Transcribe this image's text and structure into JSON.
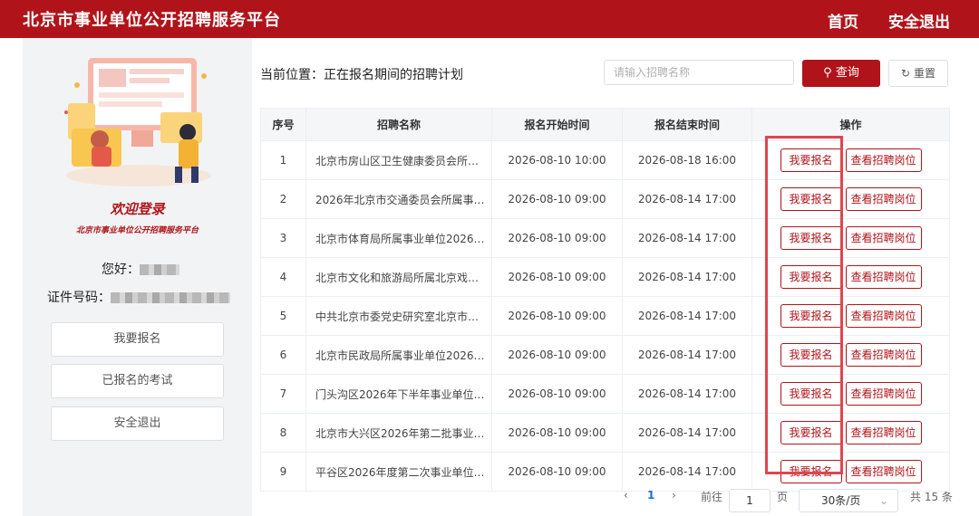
{
  "header": {
    "title": "北京市事业单位公开招聘服务平台",
    "nav_home": "首页",
    "nav_logout": "安全退出"
  },
  "sidebar": {
    "welcome": "欢迎登录",
    "platform_name": "北京市事业单位公开招聘服务平台",
    "greeting_label": "您好：",
    "id_label": "证件号码：",
    "buttons": [
      "我要报名",
      "已报名的考试",
      "安全退出"
    ]
  },
  "main": {
    "breadcrumb": "当前位置：正在报名期间的招聘计划",
    "search_placeholder": "请输入招聘名称",
    "query_label": "查询",
    "reset_label": "重置",
    "columns": [
      "序号",
      "招聘名称",
      "报名开始时间",
      "报名结束时间",
      "操作"
    ],
    "apply_label": "我要报名",
    "view_label": "查看招聘岗位",
    "rows": [
      {
        "no": "1",
        "name": "北京市房山区卫生健康委员会所…",
        "start": "2026-08-10 10:00",
        "end": "2026-08-18 16:00"
      },
      {
        "no": "2",
        "name": "2026年北京市交通委员会所属事…",
        "start": "2026-08-10 09:00",
        "end": "2026-08-14 17:00"
      },
      {
        "no": "3",
        "name": "北京市体育局所属事业单位2026…",
        "start": "2026-08-10 09:00",
        "end": "2026-08-14 17:00"
      },
      {
        "no": "4",
        "name": "北京市文化和旅游局所属北京戏…",
        "start": "2026-08-10 09:00",
        "end": "2026-08-14 17:00"
      },
      {
        "no": "5",
        "name": "中共北京市委党史研究室北京市…",
        "start": "2026-08-10 09:00",
        "end": "2026-08-14 17:00"
      },
      {
        "no": "6",
        "name": "北京市民政局所属事业单位2026…",
        "start": "2026-08-10 09:00",
        "end": "2026-08-14 17:00"
      },
      {
        "no": "7",
        "name": "门头沟区2026年下半年事业单位…",
        "start": "2026-08-10 09:00",
        "end": "2026-08-14 17:00"
      },
      {
        "no": "8",
        "name": "北京市大兴区2026年第二批事业…",
        "start": "2026-08-10 09:00",
        "end": "2026-08-14 17:00"
      },
      {
        "no": "9",
        "name": "平谷区2026年度第二次事业单位…",
        "start": "2026-08-10 09:00",
        "end": "2026-08-14 17:00"
      }
    ]
  },
  "pagination": {
    "prev": "‹",
    "current": "1",
    "next": "›",
    "goto_label": "前往",
    "page_input": "1",
    "page_unit": "页",
    "page_size": "30条/页",
    "total": "共 15 条"
  }
}
